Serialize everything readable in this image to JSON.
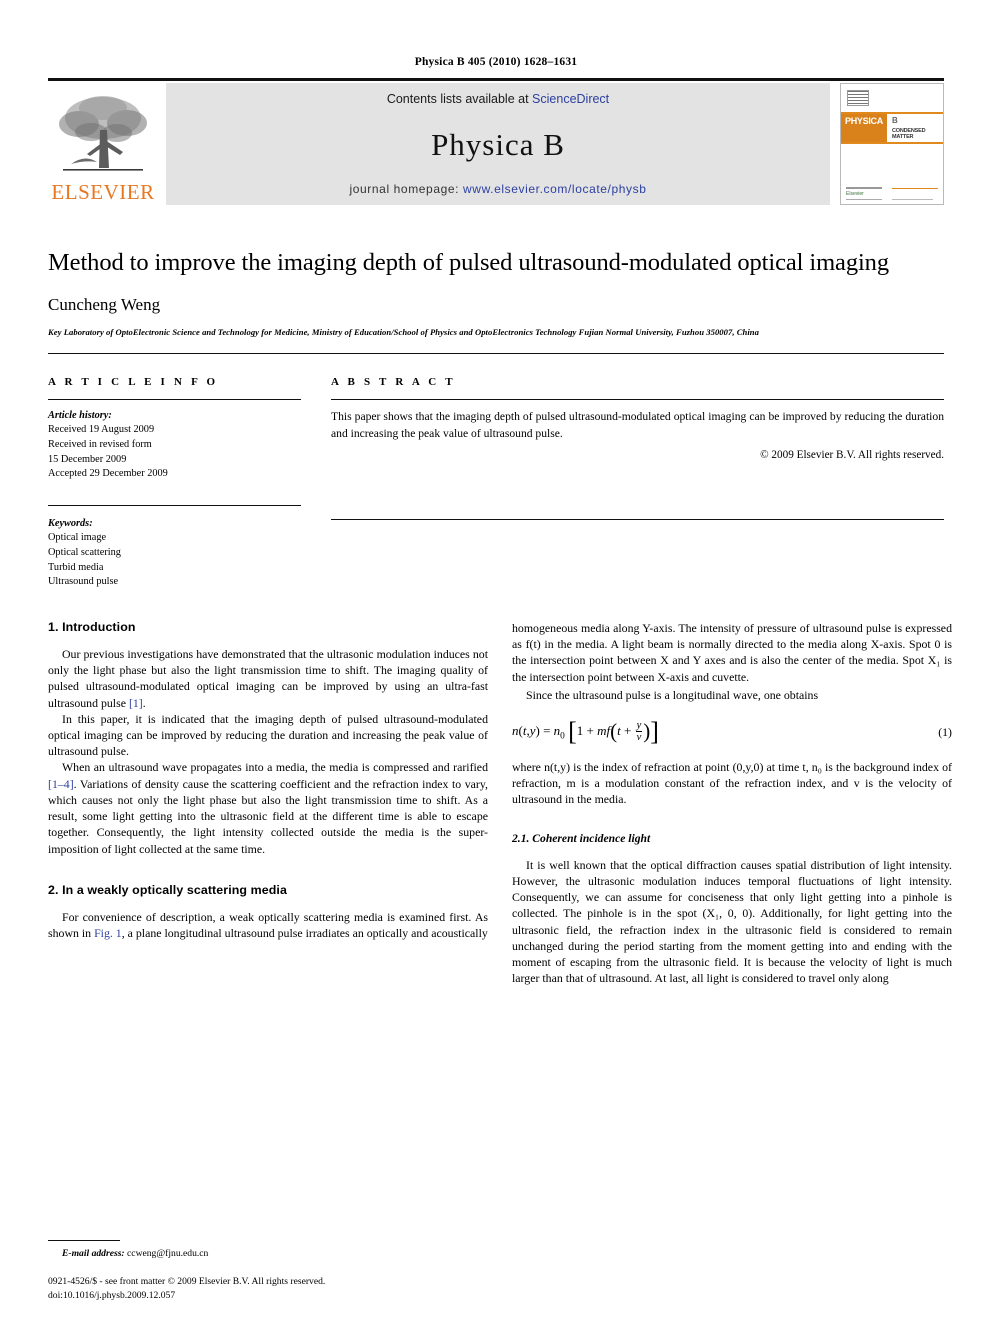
{
  "running_head": "Physica B 405 (2010) 1628–1631",
  "masthead": {
    "publisher_name": "ELSEVIER",
    "contents_prefix": "Contents lists available at",
    "contents_link": "ScienceDirect",
    "journal_title": "Physica B",
    "homepage_prefix": "journal homepage:",
    "homepage_url": "www.elsevier.com/locate/physb",
    "cover": {
      "brand": "PHYSICA",
      "volume_letter": "B",
      "subtitle": "CONDENSED MATTER",
      "imprint": "Elsevier"
    }
  },
  "article": {
    "title": "Method to improve the imaging depth of pulsed ultrasound-modulated optical imaging",
    "author": "Cuncheng Weng",
    "affiliation": "Key Laboratory of OptoElectronic Science and Technology for Medicine, Ministry of Education/School of Physics and OptoElectronics Technology Fujian Normal University, Fuzhou 350007, China"
  },
  "info": {
    "heading": "A R T I C L E   I N F O",
    "history_label": "Article history:",
    "history": [
      "Received 19 August 2009",
      "Received in revised form",
      "15 December 2009",
      "Accepted 29 December 2009"
    ],
    "keywords_label": "Keywords:",
    "keywords": [
      "Optical image",
      "Optical scattering",
      "Turbid media",
      "Ultrasound pulse"
    ]
  },
  "abstract": {
    "heading": "A B S T R A C T",
    "text": "This paper shows that the imaging depth of pulsed ultrasound-modulated optical imaging can be improved by reducing the duration and increasing the peak value of ultrasound pulse.",
    "copyright": "© 2009 Elsevier B.V. All rights reserved."
  },
  "sections": {
    "intro_heading": "1.  Introduction",
    "intro_p1_a": "Our previous investigations have demonstrated that the ultrasonic modulation induces not only the light phase but also the light transmission time to shift. The imaging quality of pulsed ultrasound-modulated optical imaging can be improved by using an ultra-fast ultrasound pulse ",
    "intro_p1_ref": "[1]",
    "intro_p1_b": ".",
    "intro_p2": "In this paper, it is indicated that the imaging depth of pulsed ultrasound-modulated optical imaging can be improved by reducing the duration and increasing the peak value of ultrasound pulse.",
    "intro_p3_a": "When an ultrasound wave propagates into a media, the media is compressed and rarified ",
    "intro_p3_ref": "[1–4]",
    "intro_p3_b": ". Variations of density cause the scattering coefficient and the refraction index to vary, which causes not only the light phase but also the light transmission time to shift. As a result, some light getting into the ultrasonic field at the different time is able to escape together. Consequently, the light intensity collected outside the media is the super-imposition of light collected at the same time.",
    "sec2_heading": "2.  In a weakly optically scattering media",
    "sec2_p1_a": "For convenience of description, a weak optically scattering media is examined first. As shown in ",
    "sec2_p1_ref": "Fig. 1",
    "sec2_p1_b": ", a plane longitudinal ultrasound pulse irradiates an optically and acoustically",
    "right_p1": "homogeneous media along Y-axis. The intensity of pressure of ultrasound pulse is expressed as f(t) in the media. A light beam is normally directed to the media along X-axis. Spot 0 is the intersection point between X and Y axes and is also the center of the media. Spot X₁ is the intersection point between X-axis and cuvette.",
    "right_p2": "Since the ultrasound pulse is a longitudinal wave, one obtains",
    "equation_number": "(1)",
    "where_p": "where n(t,y) is the index of refraction at point (0,y,0) at time t, n₀ is the background index of refraction, m is a modulation constant of the refraction index, and v is the velocity of ultrasound in the media.",
    "sub21_heading": "2.1.  Coherent incidence light",
    "sub21_p": "It is well known that the optical diffraction causes spatial distribution of light intensity. However, the ultrasonic modulation induces temporal fluctuations of light intensity. Consequently, we can assume for conciseness that only light getting into a pinhole is collected. The pinhole is in the spot (X₁, 0, 0). Additionally, for light getting into the ultrasonic field, the refraction index in the ultrasonic field is considered to remain unchanged during the period starting from the moment getting into and ending with the moment of escaping from the ultrasonic field. It is because the velocity of light is much larger than that of ultrasound. At last, all light is considered to travel only along"
  },
  "footnote": {
    "label": "E-mail address:",
    "email": "ccweng@fjnu.edu.cn"
  },
  "page_footer": {
    "line1": "0921-4526/$ - see front matter © 2009 Elsevier B.V. All rights reserved.",
    "line2": "doi:10.1016/j.physb.2009.12.057"
  },
  "colors": {
    "link": "#2b3fa0",
    "elsevier_orange": "#E87722",
    "banner_bg": "#e3e3e3"
  }
}
